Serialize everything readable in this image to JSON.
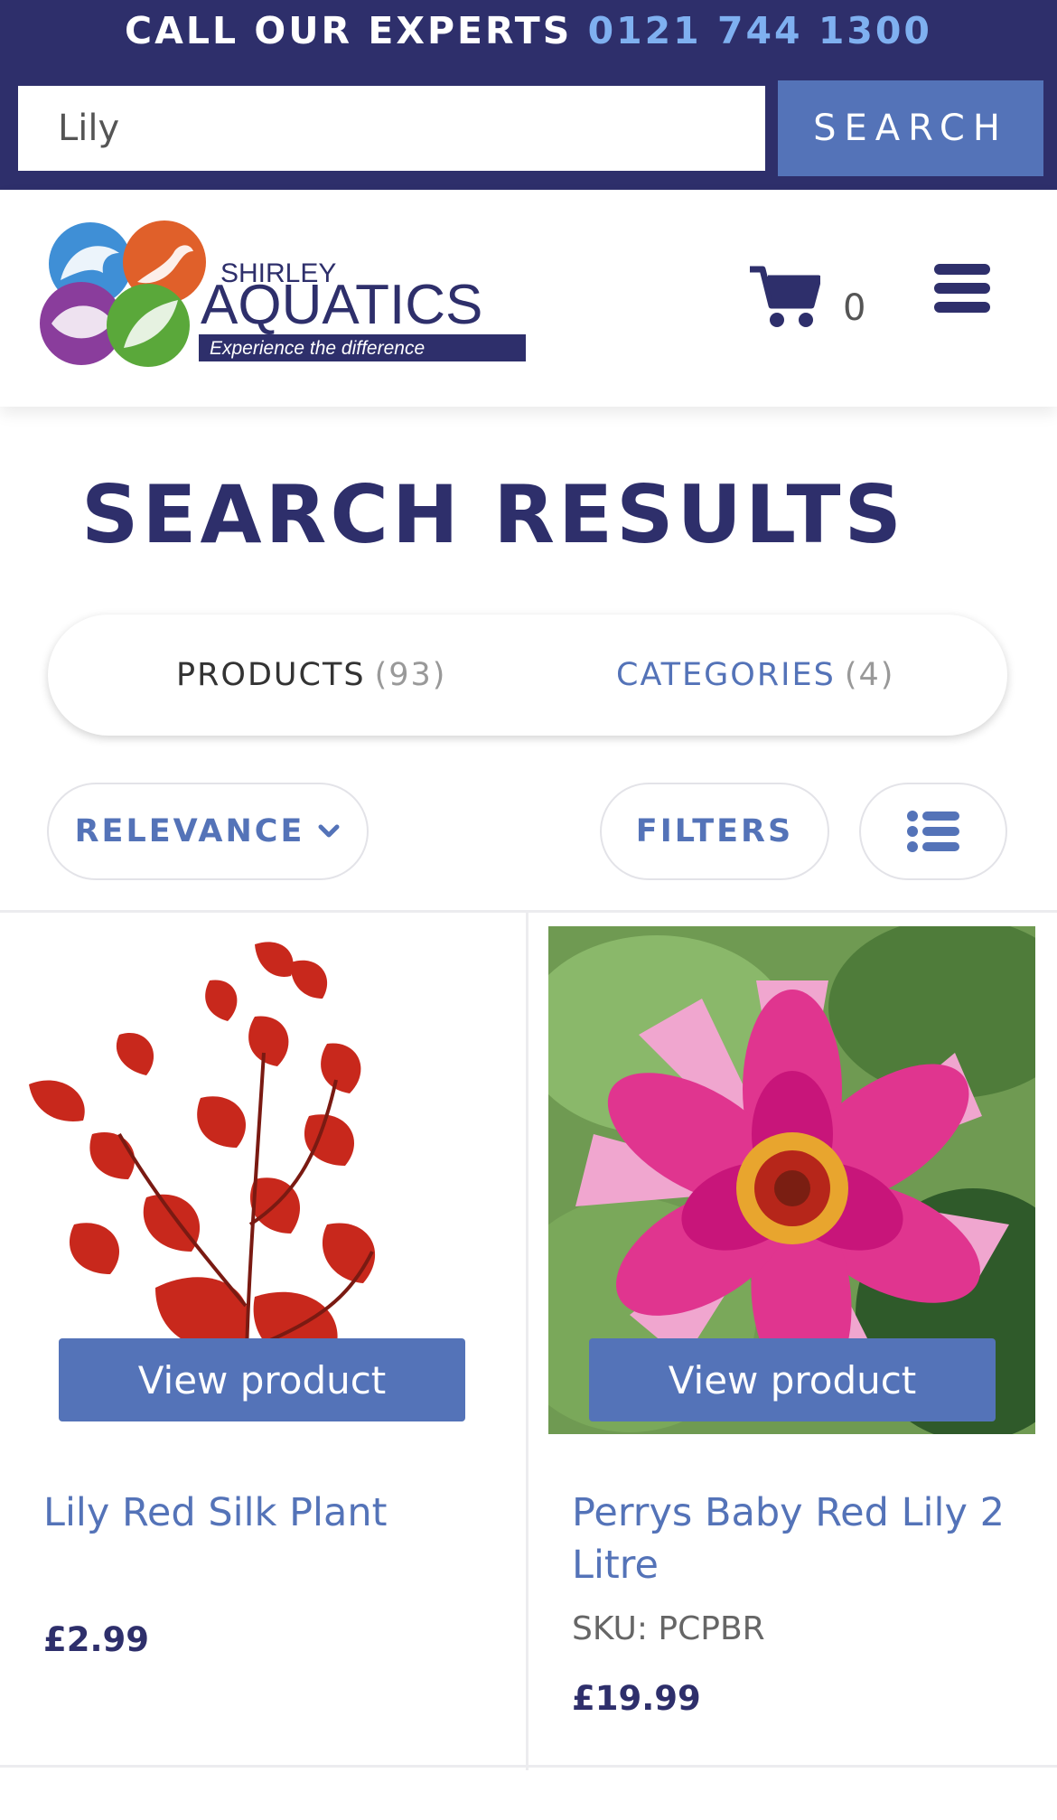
{
  "topbar": {
    "call_text": "CALL OUR EXPERTS",
    "phone": "0121 744 1300",
    "search_value": "Lily",
    "search_button": "SEARCH"
  },
  "header": {
    "brand_top": "SHIRLEY",
    "brand_main": "AQUATICS",
    "brand_tagline": "Experience the difference",
    "cart_count": "0",
    "icons": [
      "cart-icon",
      "hamburger-menu-icon"
    ]
  },
  "page": {
    "title": "SEARCH RESULTS"
  },
  "tabs": [
    {
      "label": "PRODUCTS",
      "count": "(93)",
      "active": true
    },
    {
      "label": "CATEGORIES",
      "count": "(4)",
      "active": false
    }
  ],
  "controls": {
    "sort_label": "RELEVANCE",
    "filters_label": "FILTERS",
    "view_icon": "list-view-icon"
  },
  "products": [
    {
      "name": "Lily Red Silk Plant",
      "sku": "",
      "price": "£2.99",
      "button": "View product"
    },
    {
      "name": "Perrys Baby Red Lily 2 Litre",
      "sku": "SKU: PCPBR",
      "price": "£19.99",
      "button": "View product"
    }
  ],
  "colors": {
    "navy": "#2e2f6b",
    "accent_blue": "#5473b8",
    "phone_blue": "#7fb0f0"
  }
}
